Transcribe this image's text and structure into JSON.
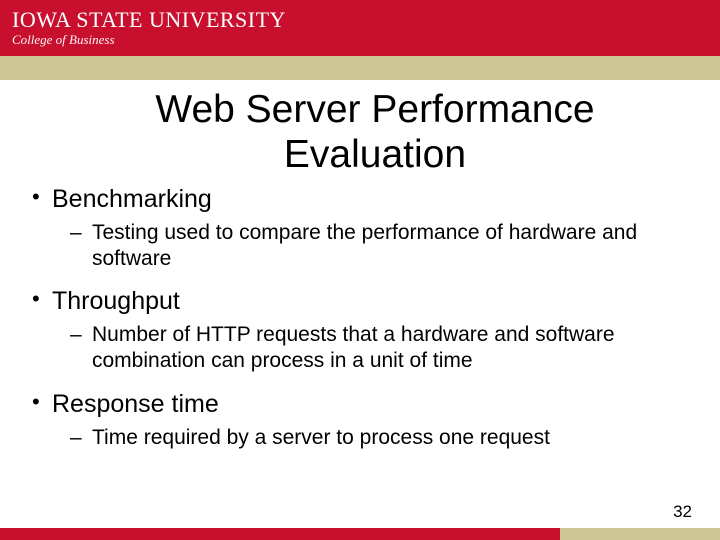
{
  "header": {
    "university": "IOWA STATE UNIVERSITY",
    "college": "College of Business"
  },
  "title": "Web Server Performance Evaluation",
  "bullets": [
    {
      "label": "Benchmarking",
      "sub": "Testing used to compare the performance of hardware and software"
    },
    {
      "label": "Throughput",
      "sub": "Number of HTTP requests that a hardware and software combination can process in a unit of time"
    },
    {
      "label": "Response time",
      "sub": "Time required by a server to process one request"
    }
  ],
  "slide_number": "32"
}
